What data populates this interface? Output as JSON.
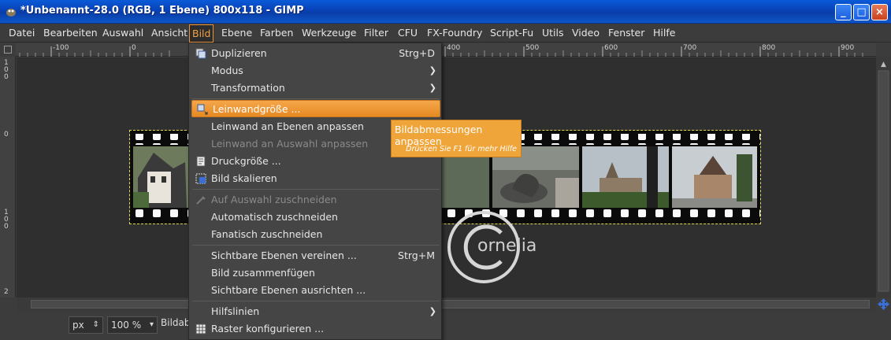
{
  "window": {
    "title": "*Unbenannt-28.0 (RGB, 1 Ebene) 800x118 - GIMP",
    "buttons": {
      "minimize": "_",
      "maximize": "□",
      "close": "×"
    }
  },
  "menubar": {
    "items": [
      {
        "label": "Datei"
      },
      {
        "label": "Bearbeiten"
      },
      {
        "label": "Auswahl"
      },
      {
        "label": "Ansicht"
      },
      {
        "label": "Bild"
      },
      {
        "label": "Ebene"
      },
      {
        "label": "Farben"
      },
      {
        "label": "Werkzeuge"
      },
      {
        "label": "Filter"
      },
      {
        "label": "CFU"
      },
      {
        "label": "FX-Foundry"
      },
      {
        "label": "Script-Fu"
      },
      {
        "label": "Utils"
      },
      {
        "label": "Video"
      },
      {
        "label": "Fenster"
      },
      {
        "label": "Hilfe"
      }
    ],
    "active": "Bild"
  },
  "ruler": {
    "top_labels": [
      "-100",
      "0",
      "400",
      "500",
      "600",
      "700",
      "800",
      "900"
    ],
    "left_labels": [
      "100",
      "0",
      "100",
      "2"
    ]
  },
  "bild_menu": {
    "items": [
      {
        "label": "Duplizieren",
        "accel": "Strg+D",
        "icon": "duplicate-icon"
      },
      {
        "label": "Modus",
        "submenu": true
      },
      {
        "label": "Transformation",
        "submenu": true
      },
      {
        "label": "Leinwandgröße ...",
        "icon": "canvas-size-icon",
        "highlighted": true
      },
      {
        "label": "Leinwand an Ebenen anpassen"
      },
      {
        "label": "Leinwand an Auswahl anpassen",
        "disabled": true
      },
      {
        "label": "Druckgröße ...",
        "icon": "print-size-icon"
      },
      {
        "label": "Bild skalieren",
        "icon": "scale-icon"
      },
      {
        "label": "Auf Auswahl zuschneiden",
        "icon": "crop-icon",
        "disabled": true
      },
      {
        "label": "Automatisch zuschneiden"
      },
      {
        "label": "Fanatisch zuschneiden"
      },
      {
        "label": "Sichtbare Ebenen vereinen ...",
        "accel": "Strg+M"
      },
      {
        "label": "Bild zusammenfügen"
      },
      {
        "label": "Sichtbare Ebenen ausrichten ..."
      },
      {
        "label": "Hilfslinien",
        "submenu": true
      },
      {
        "label": "Raster konfigurieren ...",
        "icon": "grid-icon"
      }
    ]
  },
  "tooltip": {
    "title": "Bildabmessungen anpassen",
    "hint": "Drücken Sie F1 für mehr Hilfe"
  },
  "watermark": {
    "text": "ornelia"
  },
  "statusbar": {
    "unit": "px",
    "zoom": "100 %",
    "message": "Bildab"
  },
  "colors": {
    "accent": "#e8923a",
    "background": "#3c3c3c",
    "titlebar": "#0a4fcc"
  }
}
